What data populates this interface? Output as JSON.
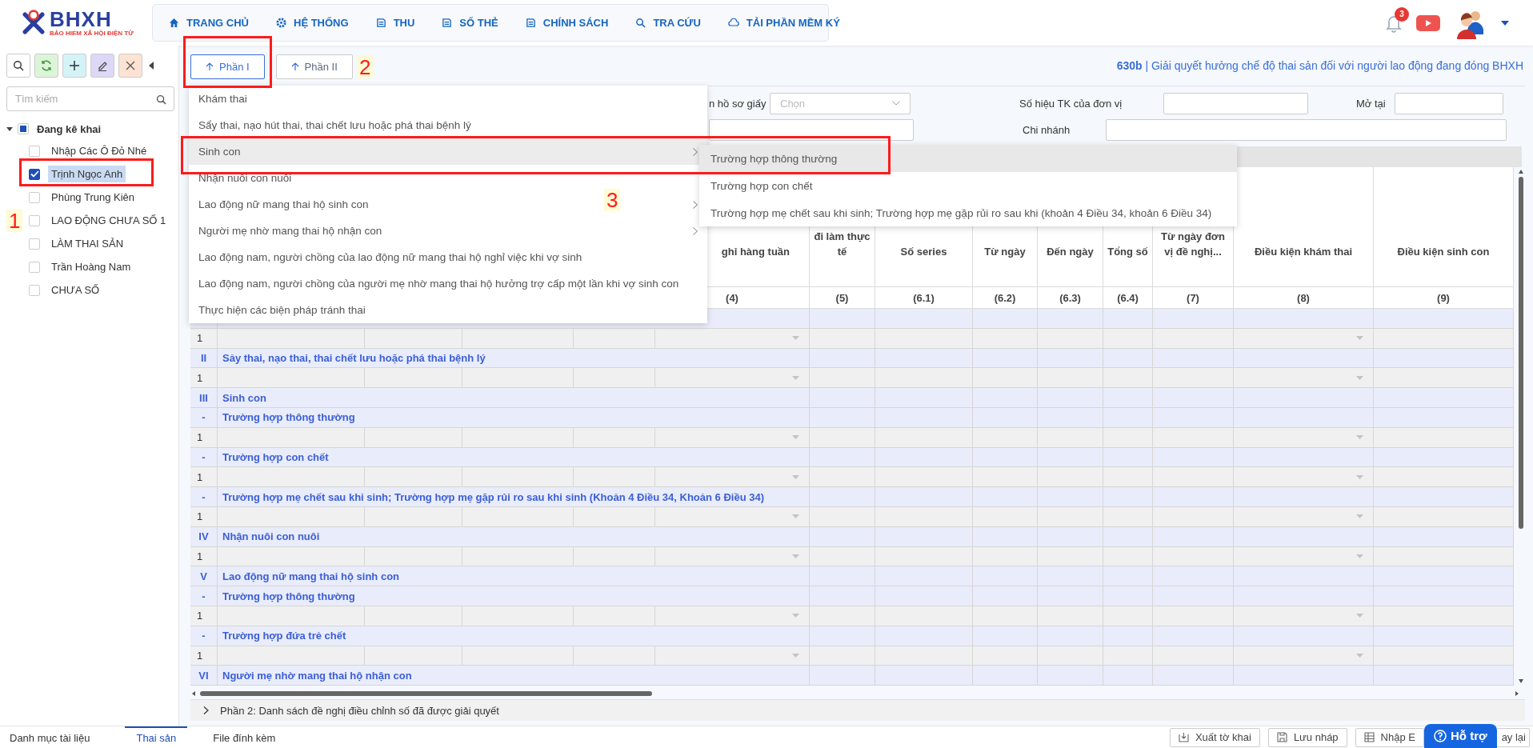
{
  "header": {
    "logo": {
      "title": "BHXH",
      "subtitle": "BẢO HIỂM XÃ HỘI ĐIỆN TỬ"
    },
    "nav": [
      {
        "label": "TRANG CHỦ"
      },
      {
        "label": "HỆ THỐNG"
      },
      {
        "label": "THU"
      },
      {
        "label": "SỐ THẺ"
      },
      {
        "label": "CHÍNH SÁCH"
      },
      {
        "label": "TRA CỨU"
      },
      {
        "label": "TẢI PHẦN MỀM KÝ"
      }
    ],
    "notifications": {
      "count": "3"
    }
  },
  "sidebar": {
    "search": {
      "placeholder": "Tìm kiếm"
    },
    "tree": {
      "label": "Đang kê khai",
      "expanded": true,
      "indeterminate": true,
      "children": [
        {
          "label": "Nhập Các Ô Đỏ Nhé",
          "checked": false,
          "selected": false
        },
        {
          "label": "Trịnh Ngọc Anh",
          "checked": true,
          "selected": true
        },
        {
          "label": "Phùng Trung Kiên",
          "checked": false,
          "selected": false
        },
        {
          "label": "LAO ĐỘNG CHƯA SỐ 1",
          "checked": false,
          "selected": false
        },
        {
          "label": "LÀM THAI SẢN",
          "checked": false,
          "selected": false
        },
        {
          "label": "Trần Hoàng Nam",
          "checked": false,
          "selected": false
        },
        {
          "label": "CHƯA SỐ",
          "checked": false,
          "selected": false
        }
      ]
    }
  },
  "tabs": [
    {
      "label": "Phần I",
      "selected": true
    },
    {
      "label": "Phần II",
      "selected": false
    }
  ],
  "title": "**630b** | Giải quyết hưởng chế độ thai sản đối với người lao động đang đóng BHXH",
  "form": {
    "row_1": [
      {
        "kind": "select",
        "label": "n hồ sơ giấy",
        "placeholder": "Chọn"
      },
      {
        "kind": "input",
        "label": "Số hiệu TK của đơn vị"
      },
      {
        "kind": "input",
        "label": "Mở tại"
      }
    ],
    "row_2": [
      {
        "kind": "input"
      },
      {
        "kind": "input",
        "label": "Chi nhánh"
      }
    ]
  },
  "menu": {
    "items": [
      {
        "label": "Khám thai",
        "has_submenu": false,
        "selected": false
      },
      {
        "label": "Sẩy thai, nạo hút thai, thai chết lưu hoặc phá thai bệnh lý",
        "has_submenu": false,
        "selected": false
      },
      {
        "label": "Sinh con",
        "has_submenu": true,
        "selected": true
      },
      {
        "label": "Nhận nuôi con nuôi",
        "has_submenu": false,
        "selected": false
      },
      {
        "label": "Lao động nữ mang thai hộ sinh con",
        "has_submenu": true,
        "selected": false
      },
      {
        "label": "Người mẹ nhờ mang thai hộ nhận con",
        "has_submenu": true,
        "selected": false
      },
      {
        "label": "Lao động nam, người chồng của lao động nữ mang thai hộ nghỉ việc khi vợ sinh",
        "has_submenu": false,
        "selected": false
      },
      {
        "label": "Lao động nam, người chồng của người mẹ nhờ mang thai hộ hưởng trợ cấp một lần khi vợ sinh con",
        "has_submenu": false,
        "selected": false
      },
      {
        "label": "Thực hiện các biện pháp tránh thai",
        "has_submenu": false,
        "selected": false
      }
    ],
    "submenu": [
      {
        "label": "Trường hợp thông thường",
        "selected": true
      },
      {
        "label": "Trường hợp con chết",
        "selected": false
      },
      {
        "label": "Trường hợp mẹ chết sau khi sinh; Trường hợp mẹ gặp rủi ro sau khi (khoản 4 Điều 34, khoản 6 Điều 34)",
        "selected": false
      }
    ]
  },
  "table": {
    "columns": [
      {},
      {},
      {},
      {},
      {},
      {
        "header": "ghỉ hàng tuần",
        "number": "(4)"
      },
      {
        "header": "đi làm thực tế",
        "number": "(5)"
      },
      {
        "header": "Số series",
        "number": "(6.1)"
      },
      {
        "header": "Từ ngày",
        "number": "(6.2)"
      },
      {
        "header": "Đến ngày",
        "number": "(6.3)"
      },
      {
        "header": "Tổng số",
        "number": "(6.4)"
      },
      {
        "header": "Từ ngày đơn vị đề nghị...",
        "number": "(7)"
      },
      {
        "header": "Điều kiện khám thai",
        "number": "(8)"
      },
      {
        "header": "Điều kiện sinh con",
        "number": "(9)"
      }
    ],
    "rows": [
      {
        "kind": "section"
      },
      {
        "kind": "item",
        "index": "1"
      },
      {
        "kind": "section",
        "index": "II",
        "label": "Sảy thai, nạo thai, thai chết lưu hoặc phá thai bệnh lý"
      },
      {
        "kind": "item",
        "index": "1"
      },
      {
        "kind": "section",
        "index": "III",
        "label": "Sinh con"
      },
      {
        "kind": "section",
        "index": "-",
        "label": "Trường hợp thông thường"
      },
      {
        "kind": "item",
        "index": "1"
      },
      {
        "kind": "section",
        "index": "-",
        "label": "Trường hợp con chết"
      },
      {
        "kind": "item",
        "index": "1"
      },
      {
        "kind": "section",
        "index": "-",
        "label": "Trường hợp mẹ chết sau khi sinh; Trường hợp mẹ gặp rủi ro sau khi sinh (Khoản 4 Điều 34, Khoản 6 Điều 34)"
      },
      {
        "kind": "item",
        "index": "1"
      },
      {
        "kind": "section",
        "index": "IV",
        "label": "Nhận nuôi con nuôi"
      },
      {
        "kind": "item",
        "index": "1"
      },
      {
        "kind": "section",
        "index": "V",
        "label": "Lao động nữ mang thai hộ sinh con"
      },
      {
        "kind": "section",
        "index": "-",
        "label": "Trường hợp thông thường"
      },
      {
        "kind": "item",
        "index": "1"
      },
      {
        "kind": "section",
        "index": "-",
        "label": "Trường hợp đứa trẻ chết"
      },
      {
        "kind": "item",
        "index": "1"
      },
      {
        "kind": "section",
        "index": "VI",
        "label": "Người mẹ nhờ mang thai hộ nhận con"
      }
    ]
  },
  "part_2": {
    "label": "Phần 2: Danh sách đề nghị điều chỉnh số đã được giải quyết",
    "expanded": false
  },
  "bottom": {
    "tabs": [
      {
        "label": "Danh mục tài liệu",
        "selected": false
      },
      {
        "label": "Thai sản",
        "selected": true
      },
      {
        "label": "File đính kèm",
        "selected": false
      }
    ],
    "actions": [
      {
        "label": "Xuất tờ khai"
      },
      {
        "label": "Lưu nháp"
      },
      {
        "label": "Nhập E"
      }
    ],
    "help": {
      "label": "Hỗ trợ"
    },
    "cut_action": {
      "label": "ay lại"
    }
  },
  "annotations": [
    {
      "label": "1"
    },
    {
      "label": "2"
    },
    {
      "label": "3"
    }
  ]
}
